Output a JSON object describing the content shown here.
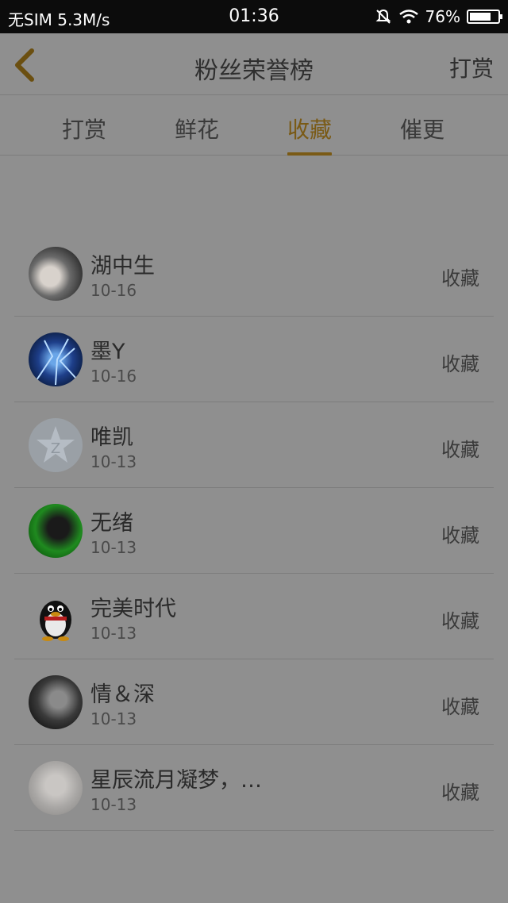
{
  "status_bar": {
    "carrier": "无SIM",
    "speed": "5.3M/s",
    "time": "01:36",
    "battery": "76%",
    "battery_level": 0.76
  },
  "nav": {
    "title": "粉丝荣誉榜",
    "action": "打赏"
  },
  "tabs": [
    {
      "label": "打赏",
      "active": false
    },
    {
      "label": "鲜花",
      "active": false
    },
    {
      "label": "收藏",
      "active": true
    },
    {
      "label": "催更",
      "active": false
    }
  ],
  "colors": {
    "accent": "#7a5a15",
    "background": "#8f8f8f"
  },
  "fans": [
    {
      "name": "湖中生",
      "date": "10-16",
      "action": "收藏",
      "avatar": "photo-avatar"
    },
    {
      "name": "墨Y",
      "date": "10-16",
      "action": "收藏",
      "avatar": "blue-abstract-avatar"
    },
    {
      "name": "唯凯",
      "date": "10-13",
      "action": "收藏",
      "avatar": "qzone-star-avatar"
    },
    {
      "name": "无绪",
      "date": "10-13",
      "action": "收藏",
      "avatar": "green-photo-avatar"
    },
    {
      "name": "完美时代",
      "date": "10-13",
      "action": "收藏",
      "avatar": "qq-penguin-avatar"
    },
    {
      "name": "情＆深",
      "date": "10-13",
      "action": "收藏",
      "avatar": "portrait-avatar"
    },
    {
      "name": "星辰流月凝梦，…",
      "date": "10-13",
      "action": "收藏",
      "avatar": "light-photo-avatar"
    }
  ]
}
